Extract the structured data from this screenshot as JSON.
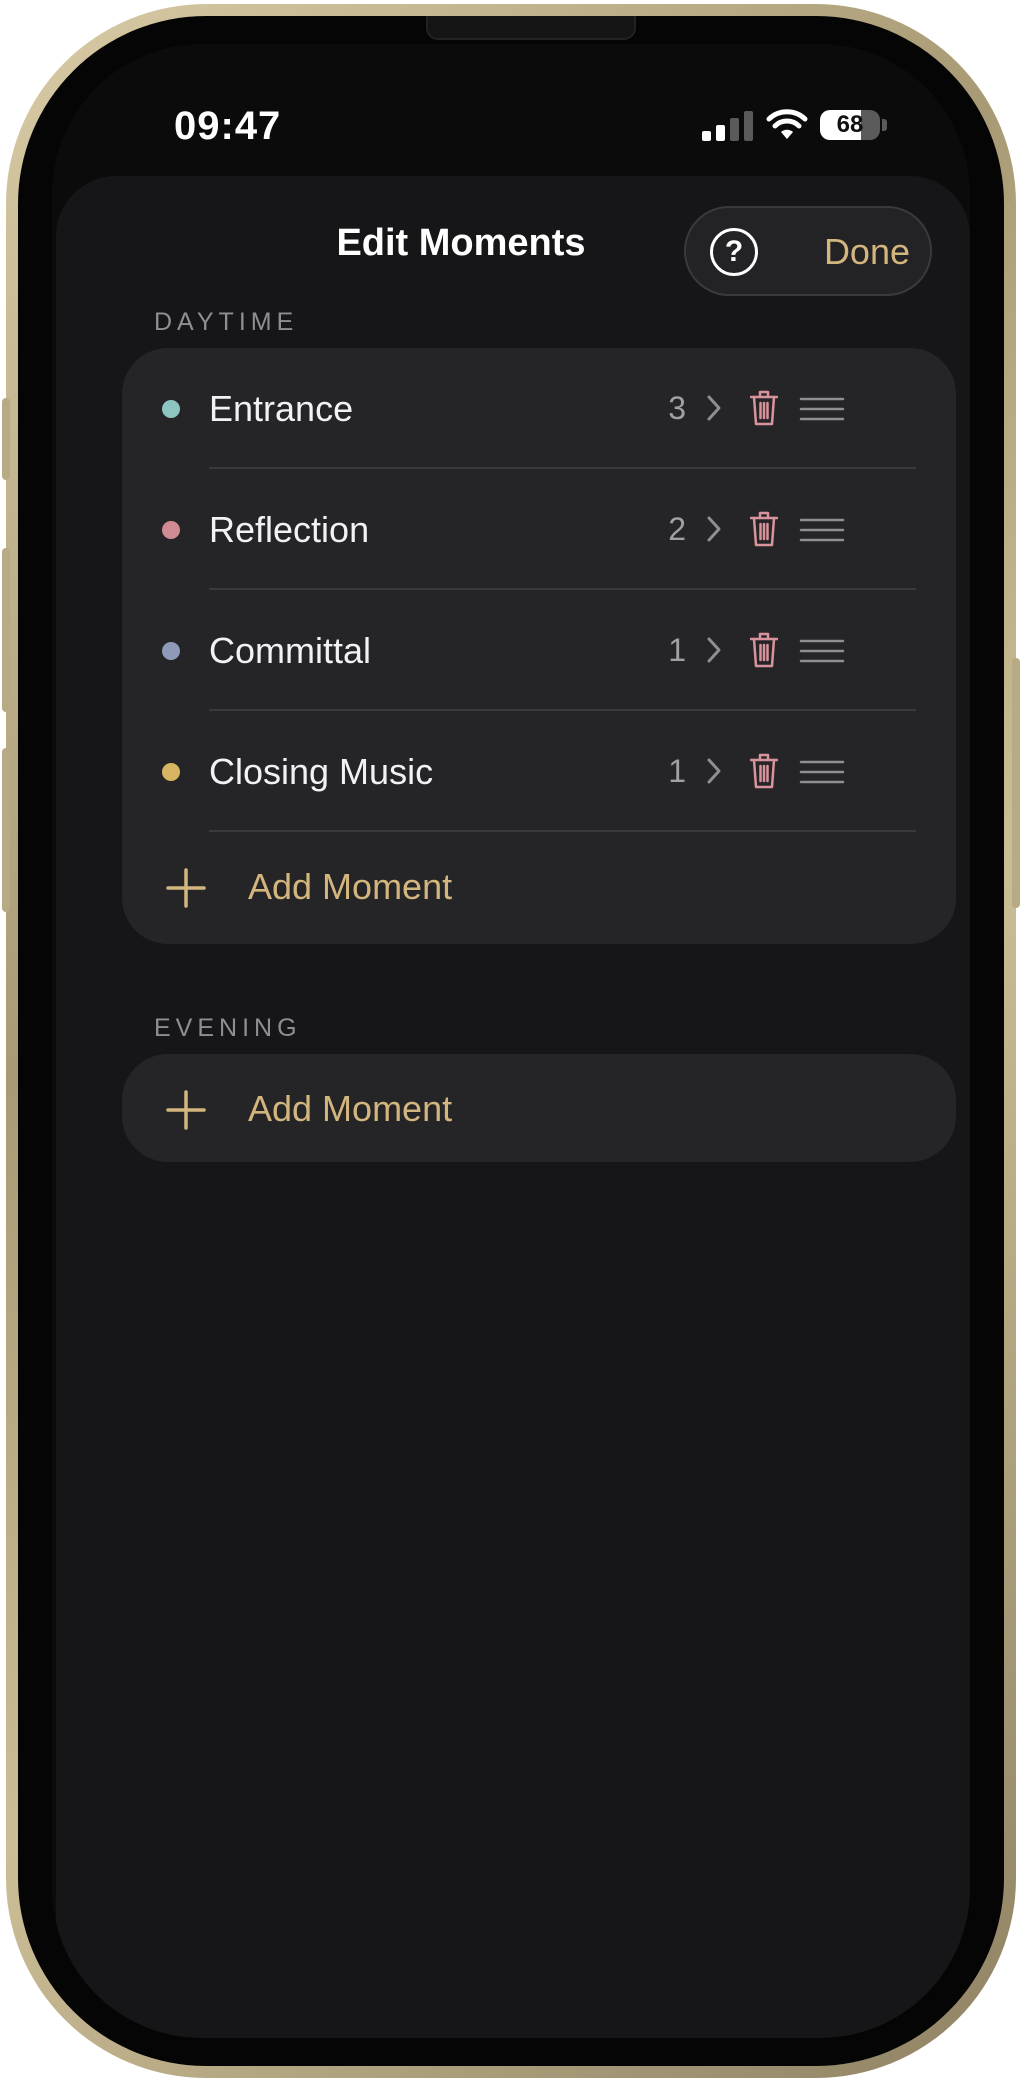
{
  "status_bar": {
    "time": "09:47",
    "battery_level": 68,
    "battery_text": "68",
    "icons": [
      "cellular-signal-icon",
      "wifi-icon",
      "battery-icon"
    ]
  },
  "nav": {
    "title": "Edit Moments",
    "help_symbol": "?",
    "done_label": "Done"
  },
  "sections": [
    {
      "header": "DAYTIME",
      "moments": [
        {
          "label": "Entrance",
          "count": "3",
          "color": "#8fc5c1"
        },
        {
          "label": "Reflection",
          "count": "2",
          "color": "#cf8a93"
        },
        {
          "label": "Committal",
          "count": "1",
          "color": "#8e9ab8"
        },
        {
          "label": "Closing Music",
          "count": "1",
          "color": "#d8b562"
        }
      ],
      "add_label": "Add Moment"
    },
    {
      "header": "EVENING",
      "moments": [],
      "add_label": "Add Moment"
    }
  ],
  "colors": {
    "accent": "#d3b57e",
    "delete": "#d9939c",
    "sheet_background": "#161618",
    "card_background": "#252527"
  }
}
